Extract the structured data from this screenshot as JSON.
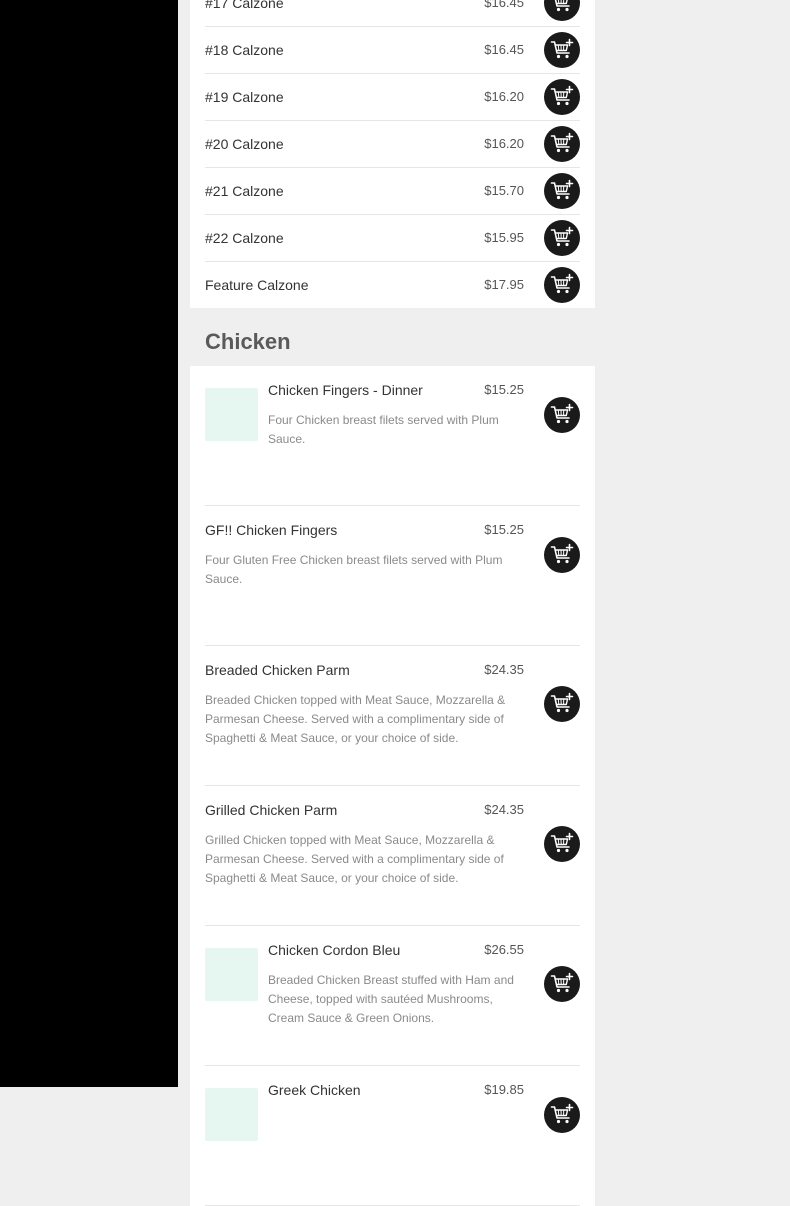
{
  "calzones": [
    {
      "name": "#17 Calzone",
      "price": "$16.45"
    },
    {
      "name": "#18 Calzone",
      "price": "$16.45"
    },
    {
      "name": "#19 Calzone",
      "price": "$16.20"
    },
    {
      "name": "#20 Calzone",
      "price": "$16.20"
    },
    {
      "name": "#21 Calzone",
      "price": "$15.70"
    },
    {
      "name": "#22 Calzone",
      "price": "$15.95"
    },
    {
      "name": "Feature Calzone",
      "price": "$17.95"
    }
  ],
  "chicken": {
    "heading": "Chicken",
    "items": [
      {
        "title": "Chicken Fingers - Dinner",
        "price": "$15.25",
        "description": "Four Chicken breast filets served with Plum Sauce."
      },
      {
        "title": "GF!! Chicken Fingers",
        "price": "$15.25",
        "description": "Four Gluten Free Chicken breast filets served with Plum Sauce."
      },
      {
        "title": "Breaded Chicken Parm",
        "price": "$24.35",
        "description": "Breaded Chicken topped with Meat Sauce, Mozzarella & Parmesan Cheese. Served with a complimentary side of Spaghetti & Meat Sauce, or your choice of side."
      },
      {
        "title": "Grilled Chicken Parm",
        "price": "$24.35",
        "description": "Grilled Chicken topped with Meat Sauce, Mozzarella & Parmesan Cheese. Served with a complimentary side of Spaghetti & Meat Sauce, or your choice of side."
      },
      {
        "title": "Chicken Cordon Bleu",
        "price": "$26.55",
        "description": "Breaded Chicken Breast stuffed with Ham and Cheese, topped with sautéed Mushrooms, Cream Sauce & Green Onions."
      },
      {
        "title": "Greek Chicken",
        "price": "$19.85",
        "description": ""
      }
    ]
  },
  "icons": {
    "add_to_cart": "cart-plus-icon"
  },
  "colors": {
    "sidebar": "#000000",
    "cart_button": "#1a1a1a",
    "thumbnail": "#e6f7f2",
    "page_bg": "#efefef"
  }
}
